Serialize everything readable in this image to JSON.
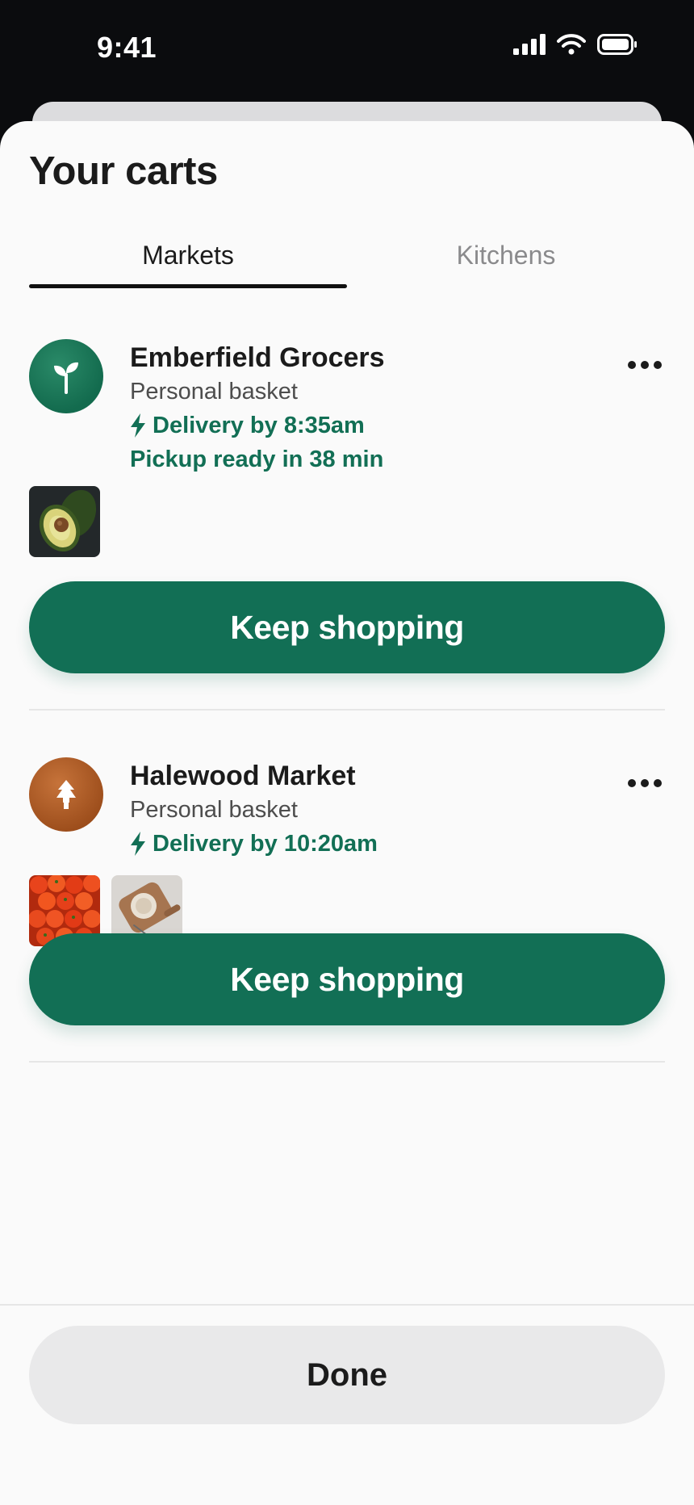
{
  "status_bar": {
    "time": "9:41"
  },
  "sheet": {
    "title": "Your carts",
    "tabs": [
      {
        "label": "Markets",
        "selected": true
      },
      {
        "label": "Kitchens",
        "selected": false
      }
    ]
  },
  "carts": [
    {
      "store_name": "Emberfield Grocers",
      "basket_type": "Personal basket",
      "delivery": "Delivery by 8:35am",
      "pickup": "Pickup ready in 38 min",
      "avatar_icon": "sprout-icon",
      "avatar_color": "#136b4e",
      "items": [
        "avocado"
      ],
      "button_label": "Keep shopping"
    },
    {
      "store_name": "Halewood Market",
      "basket_type": "Personal basket",
      "delivery": "Delivery by 10:20am",
      "avatar_icon": "pine-tree-icon",
      "avatar_color": "#9c4d1b",
      "items": [
        "tomatoes",
        "bread-on-board"
      ],
      "button_label": "Keep shopping"
    }
  ],
  "footer": {
    "done_label": "Done"
  },
  "colors": {
    "accent": "#126f55",
    "done_bg": "#e9e9ea"
  }
}
